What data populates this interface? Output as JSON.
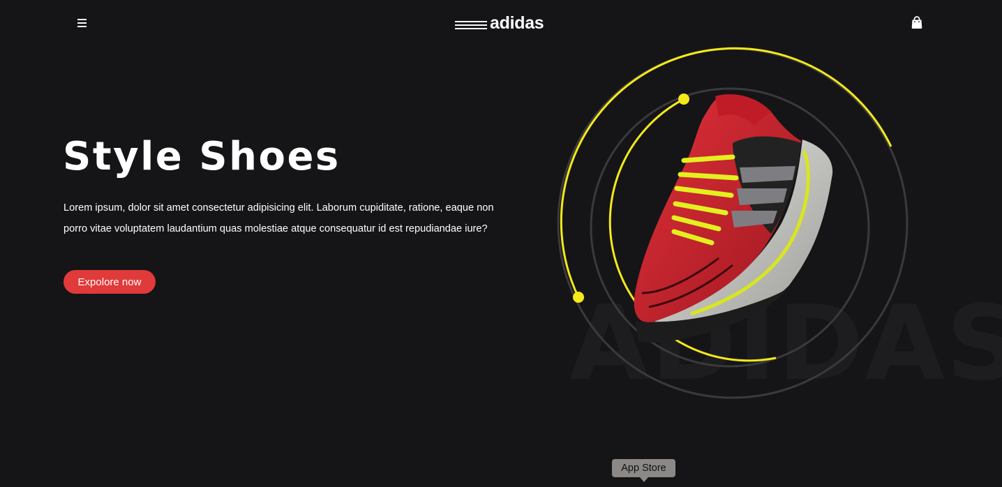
{
  "header": {
    "menu_icon": "hamburger-menu-icon",
    "logo_text": "adidas",
    "logo_icon": "adidas-stripes-icon",
    "cart_icon": "shopping-bag-icon"
  },
  "hero": {
    "title": "Style Shoes",
    "description": "Lorem ipsum, dolor sit amet consectetur adipisicing elit. Laborum cupiditate, ratione, eaque non porro vitae voluptatem laudantium quas molestiae atque consequatur id est repudiandae iure?",
    "cta_label": "Expolore now"
  },
  "visual": {
    "watermark_text": "ADIDAS",
    "product_image": "red-running-shoe-image"
  },
  "tooltip": {
    "label": "App Store"
  },
  "colors": {
    "background": "#151517",
    "accent_red": "#e03a3a",
    "accent_yellow": "#f5e91a",
    "ring_gray": "#3a3a3c",
    "text": "#ffffff"
  }
}
